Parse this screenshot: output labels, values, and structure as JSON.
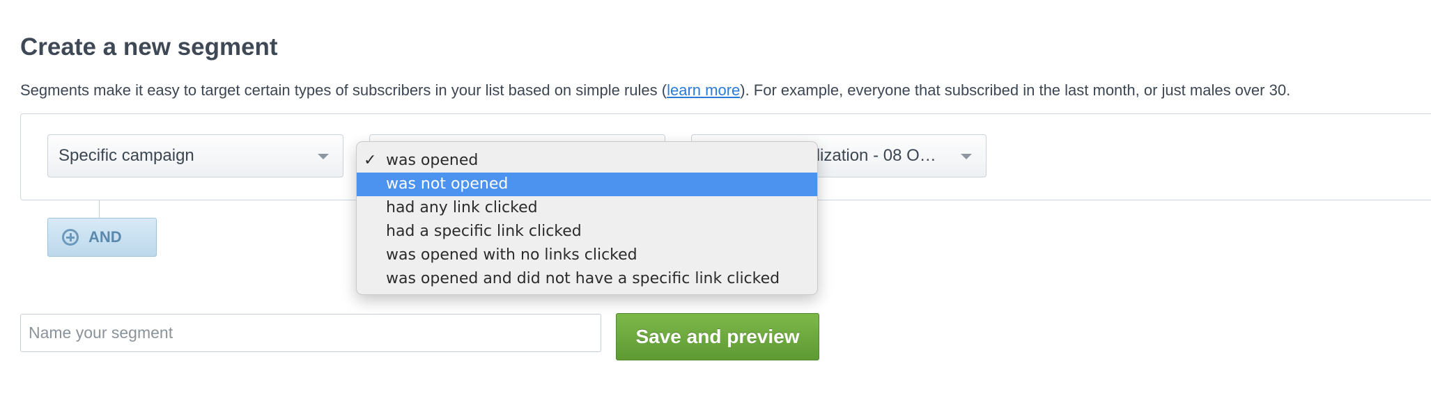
{
  "page": {
    "title": "Create a new segment",
    "intro_before": "Segments make it easy to target certain types of subscribers in your list based on simple rules (",
    "intro_link": "learn more",
    "intro_after": "). For example, everyone that subscribed in the last month, or just males over 30."
  },
  "rule": {
    "field_select": "Specific campaign",
    "operator_select": "",
    "campaign_select": "nalization - 08 O…"
  },
  "and_button": "AND",
  "operator_menu": {
    "checked_index": 0,
    "highlighted_index": 1,
    "check_glyph": "✓",
    "options": [
      "was opened",
      "was not opened",
      "had any link clicked",
      "had a specific link clicked",
      "was opened with no links clicked",
      "was opened and did not have a specific link clicked"
    ]
  },
  "name_input": {
    "placeholder": "Name your segment",
    "value": ""
  },
  "save_button": "Save and preview",
  "colors": {
    "highlight": "#4c93ef",
    "save_green": "#6aa83b",
    "and_blue": "#c6e0f1",
    "link": "#2a7ad9"
  }
}
